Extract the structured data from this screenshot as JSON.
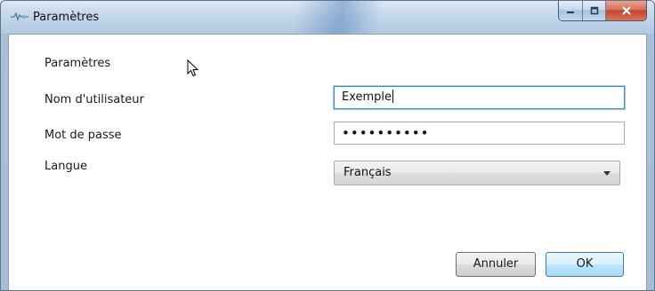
{
  "window": {
    "title": "Paramètres",
    "minimize_icon": "minimize-icon",
    "maximize_icon": "maximize-icon",
    "close_icon": "close-icon"
  },
  "form": {
    "heading": "Paramètres",
    "username_label": "Nom d'utilisateur",
    "username_value": "Exemple",
    "password_label": "Mot de passe",
    "password_value": "••••••••••",
    "language_label": "Langue",
    "language_value": "Français"
  },
  "buttons": {
    "cancel_label": "Annuler",
    "ok_label": "OK"
  },
  "colors": {
    "accent": "#3c8fd6",
    "close": "#c2442a"
  }
}
